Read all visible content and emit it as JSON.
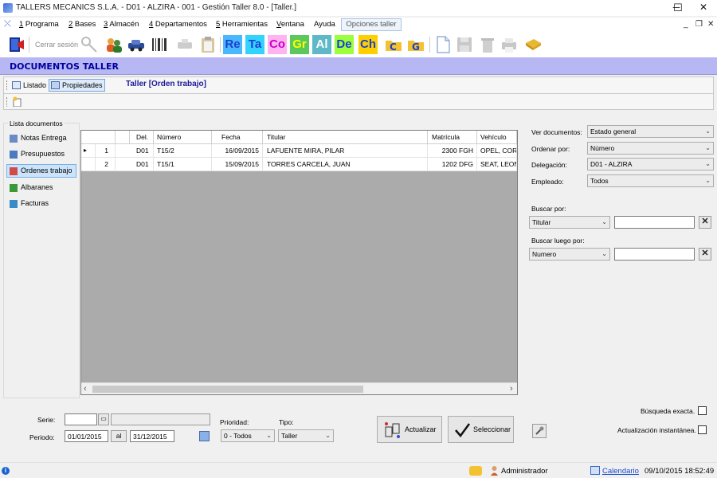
{
  "window": {
    "title": "TALLERS MECANICS S.L.A. - D01 - ALZIRA - 001 - Gestión Taller 8.0 - [Taller.]",
    "minimize": "─",
    "maximize": "☐",
    "close": "✕",
    "mdi_minimize": "_",
    "mdi_restore": "❐",
    "mdi_close": "✕"
  },
  "menu": {
    "items": [
      {
        "key": "1",
        "label": " Programa"
      },
      {
        "key": "2",
        "label": " Bases"
      },
      {
        "key": "3",
        "label": " Almacén"
      },
      {
        "key": "4",
        "label": " Departamentos"
      },
      {
        "key": "5",
        "label": " Herramientas"
      },
      {
        "key": "V",
        "label": "entana"
      },
      {
        "key": "",
        "label": "Ayuda"
      }
    ],
    "opciones": "Opciones taller"
  },
  "toolbar": {
    "cerrar_sesion": "Cerrar sesión",
    "letters": [
      {
        "text": "Re",
        "color": "#1a3fd0",
        "bg": "#4ab8ff"
      },
      {
        "text": "Ta",
        "color": "#1a3fd0",
        "bg": "#33d3ff"
      },
      {
        "text": "Co",
        "color": "#c800c8",
        "bg": "#ffb3f0"
      },
      {
        "text": "Gr",
        "color": "#ffff00",
        "bg": "#5ac85a"
      },
      {
        "text": "Al",
        "color": "#ffffff",
        "bg": "#5fb8c8"
      },
      {
        "text": "De",
        "color": "#1a3fd0",
        "bg": "#9cff3c"
      },
      {
        "text": "Ch",
        "color": "#1a3fd0",
        "bg": "#ffd000"
      }
    ]
  },
  "section": {
    "title": "DOCUMENTOS TALLER"
  },
  "tabs": {
    "listado": "Listado",
    "propiedades": "Propiedades",
    "context_title": "Taller [Orden trabajo]"
  },
  "left_panel": {
    "group_label": "Lista documentos",
    "items": [
      {
        "label": "Notas Entrega",
        "active": false
      },
      {
        "label": "Presupuestos",
        "active": false
      },
      {
        "label": "Ordenes trabajo",
        "active": true
      },
      {
        "label": "Albaranes",
        "active": false
      },
      {
        "label": "Facturas",
        "active": false
      }
    ]
  },
  "grid": {
    "columns": [
      "",
      "",
      "Del.",
      "Número",
      "Fecha",
      "Titular",
      "Matrícula",
      "Vehículo"
    ],
    "rows": [
      {
        "marker": "▸",
        "n": "1",
        "del": "D01",
        "numero": "T15/2",
        "fecha": "16/09/2015",
        "titular": "LAFUENTE MIRA, PILAR",
        "matricula": "2300 FGH",
        "vehiculo": "OPEL, CORSA"
      },
      {
        "marker": "",
        "n": "2",
        "del": "D01",
        "numero": "T15/1",
        "fecha": "15/09/2015",
        "titular": "TORRES CARCELA, JUAN",
        "matricula": "1202 DFG",
        "vehiculo": "SEAT, LEON"
      }
    ],
    "scroll_left": "‹",
    "scroll_right": "›"
  },
  "filters": {
    "ver_documentos": {
      "label": "Ver documentos:",
      "value": "Estado general"
    },
    "ordenar_por": {
      "label": "Ordenar por:",
      "value": "Número"
    },
    "delegacion": {
      "label": "Delegación:",
      "value": "D01 - ALZIRA"
    },
    "empleado": {
      "label": "Empleado:",
      "value": "Todos"
    },
    "buscar_por": {
      "label": "Buscar por:",
      "field": "Titular",
      "value": ""
    },
    "buscar_luego": {
      "label": "Buscar luego por:",
      "field": "Numero",
      "value": ""
    },
    "clear": "✕",
    "arrow": "⌄"
  },
  "bottom": {
    "serie_label": "Serie:",
    "serie_value": "",
    "serie_btn": "▭",
    "serie_desc": "",
    "periodo_label": "Periodo:",
    "periodo_from": "01/01/2015",
    "periodo_al": "al",
    "periodo_to": "31/12/2015",
    "prioridad_label": "Prioridad:",
    "prioridad_value": "0 - Todos",
    "tipo_label": "Tipo:",
    "tipo_value": "Taller",
    "actualizar": "Actualizar",
    "seleccionar": "Seleccionar",
    "busqueda_exacta": "Búsqueda exacta.",
    "actualizacion_instantanea": "Actualización instantánea."
  },
  "status": {
    "user": "Administrador",
    "calendario": "Calendario",
    "datetime": "09/10/2015 18:52:49"
  }
}
